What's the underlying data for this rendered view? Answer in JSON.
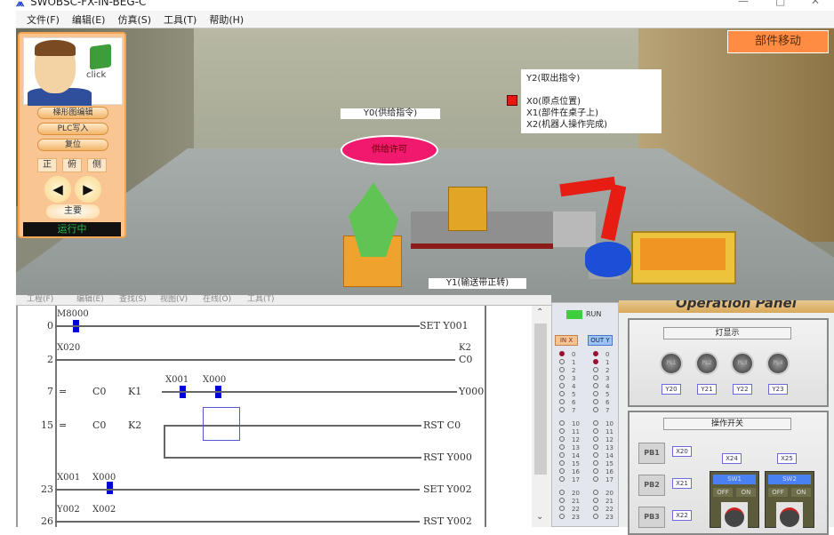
{
  "window": {
    "title": "SWOBSC-FX-IN-BEG-C",
    "minimize": "—",
    "maximize": "□",
    "close": "✕"
  },
  "menu": [
    "文件(F)",
    "编辑(E)",
    "仿真(S)",
    "工具(T)",
    "帮助(H)"
  ],
  "left_panel": {
    "click_label": "click",
    "buttons": [
      "梯形图编辑",
      "PLC写入",
      "复位"
    ],
    "views": [
      "正",
      "俯",
      "侧"
    ],
    "arrow_left": "◀",
    "arrow_right": "▶",
    "main_button": "主要",
    "status": "运行中"
  },
  "scene": {
    "move_button": "部件移动",
    "y2_label": "Y2(取出指令)",
    "x_labels": [
      "X0(原点位置)",
      "X1(部件在桌子上)",
      "X2(机器人操作完成)"
    ],
    "y0_label": "Y0(供给指令)",
    "supply_button": "供给许可",
    "y1_label": "Y1(输送带正转)"
  },
  "ladder": {
    "menu_items": [
      "工程(F)",
      "编辑(E)",
      "查找(S)",
      "视图(V)",
      "在线(O)",
      "工具(T)"
    ],
    "steps": [
      {
        "num": "0",
        "contacts": [
          "M8000"
        ],
        "coil": "SET  Y001"
      },
      {
        "num": "2",
        "contacts": [
          "X020"
        ],
        "coil": "C0",
        "coil_const": "K2"
      },
      {
        "num": "7",
        "compare": [
          "=",
          "C0",
          "K1"
        ],
        "contacts": [
          "X001",
          "X000"
        ],
        "coil": "Y000"
      },
      {
        "num": "15",
        "compare": [
          "=",
          "C0",
          "K2"
        ],
        "contacts": [],
        "coil": "RST  C0",
        "coil2": "RST  Y000"
      },
      {
        "num": "23",
        "contacts": [
          "X001",
          "X000"
        ],
        "coil": "SET  Y002"
      },
      {
        "num": "26",
        "contacts": [
          "Y002",
          "X002"
        ],
        "coil": "RST  Y002"
      }
    ],
    "scroll_up": "⌃",
    "scroll_down": "⌄"
  },
  "io_monitor": {
    "run_label": "RUN",
    "in_label": "IN X",
    "out_label": "OUT Y",
    "rows": [
      "0",
      "1",
      "2",
      "3",
      "4",
      "5",
      "6",
      "7",
      "10",
      "11",
      "12",
      "13",
      "14",
      "15",
      "16",
      "17",
      "20",
      "21",
      "22",
      "23"
    ],
    "in_on": [
      "0"
    ],
    "out_on": [
      "0",
      "1"
    ],
    "colors": {
      "on": "#9b0f2f",
      "run": "#3dcf3d"
    }
  },
  "operation_panel": {
    "title": "Operation Panel",
    "lamps_title": "灯显示",
    "lamps": [
      {
        "name": "PL1",
        "tag": "Y20"
      },
      {
        "name": "PL2",
        "tag": "Y21"
      },
      {
        "name": "PL3",
        "tag": "Y22"
      },
      {
        "name": "PL4",
        "tag": "Y23"
      }
    ],
    "switch_title": "操作开关",
    "push_buttons": [
      {
        "name": "PB1",
        "tag": "X20"
      },
      {
        "name": "PB2",
        "tag": "X21"
      },
      {
        "name": "PB3",
        "tag": "X22"
      }
    ],
    "switches": [
      {
        "name": "SW1",
        "tag": "X24",
        "off": "OFF",
        "on": "ON"
      },
      {
        "name": "SW2",
        "tag": "X25",
        "off": "OFF",
        "on": "ON"
      }
    ]
  }
}
